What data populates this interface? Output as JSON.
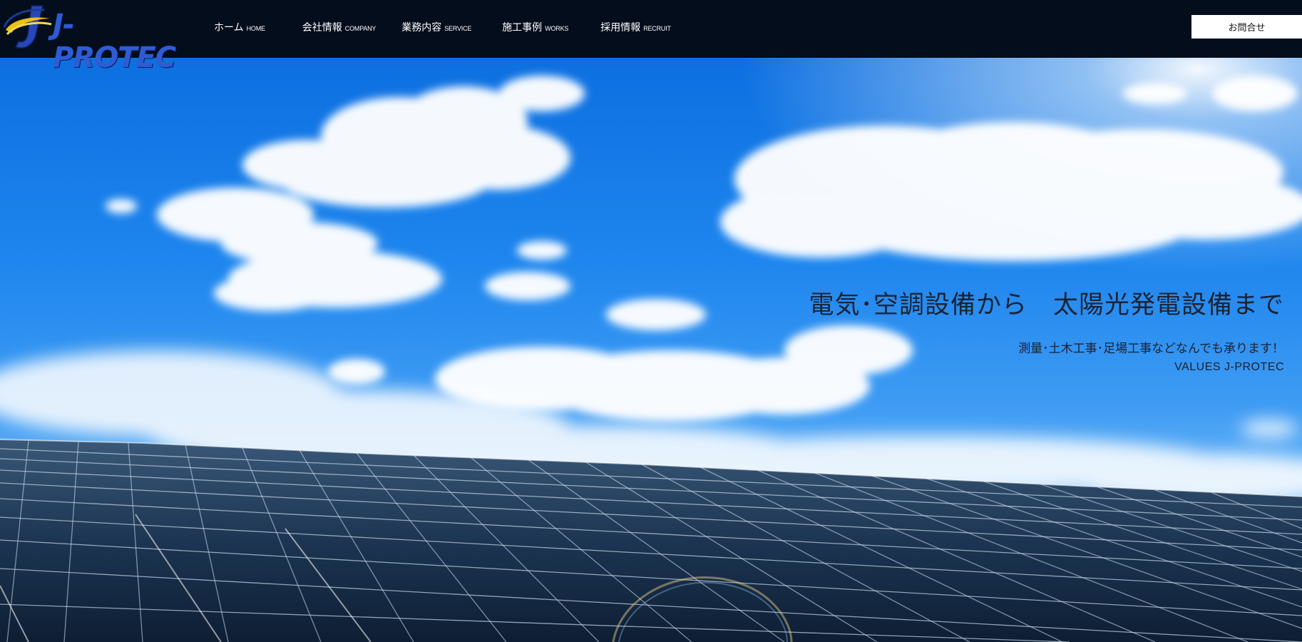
{
  "header": {
    "logo_text": "J-PROTEC",
    "nav": [
      {
        "jp": "ホーム",
        "en": "HOME"
      },
      {
        "jp": "会社情報",
        "en": "COMPANY"
      },
      {
        "jp": "業務内容",
        "en": "SERVICE"
      },
      {
        "jp": "施工事例",
        "en": "WORKS"
      },
      {
        "jp": "採用情報",
        "en": "RECRUIT"
      }
    ],
    "contact_label": "お問合せ"
  },
  "hero": {
    "title": "電気･空調設備から　太陽光発電設備まで",
    "subtitle": "測量･土木工事･足場工事などなんでも承ります！",
    "tagline": "VALUES J-PROTEC"
  },
  "colors": {
    "header_bg": "#030d1c",
    "logo_blue": "#2f5bd3",
    "logo_gold": "#e8c21a",
    "sky_blue": "#1e86ee",
    "text_dark": "#1b2233"
  },
  "icons": {
    "logo_mark": "j-swoosh-logo-icon"
  }
}
